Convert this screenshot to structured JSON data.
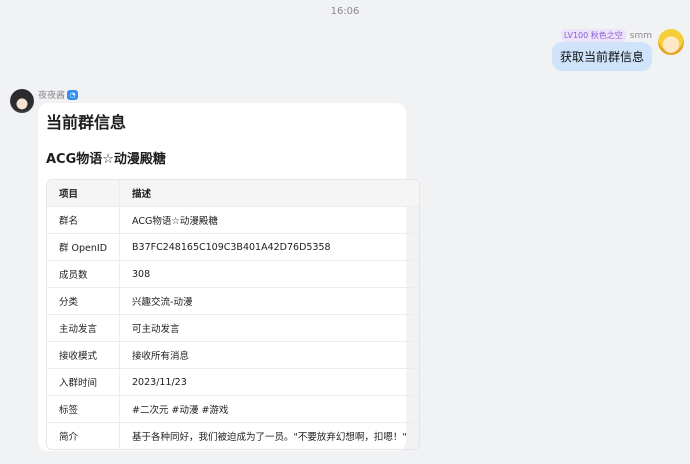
{
  "timestamp": "16:06",
  "outgoing": {
    "level_badge": "LV100 秋色之空",
    "username": "smm",
    "message": "获取当前群信息"
  },
  "incoming": {
    "sender_name": "夜夜酱",
    "bot_icon_glyph": "◔",
    "card": {
      "title": "当前群信息",
      "subtitle": "ACG物语☆动漫殿糖",
      "table": {
        "headers": [
          "项目",
          "描述"
        ],
        "rows": [
          [
            "群名",
            "ACG物语☆动漫殿糖"
          ],
          [
            "群 OpenID",
            "B37FC248165C109C3B401A42D76D5358"
          ],
          [
            "成员数",
            "308"
          ],
          [
            "分类",
            "兴趣交流-动漫"
          ],
          [
            "主动发言",
            "可主动发言"
          ],
          [
            "接收模式",
            "接收所有消息"
          ],
          [
            "入群时间",
            "2023/11/23"
          ],
          [
            "标签",
            "#二次元 #动漫 #游戏"
          ],
          [
            "简介",
            "基于各种同好，我们被迫成为了一员。\"不要放弃幻想啊，扣嗯！\""
          ]
        ]
      }
    }
  },
  "colors": {
    "background": "#f1f2f4",
    "outgoing_bubble": "#cfe4fb",
    "level_badge_text": "#8a5cd6",
    "bot_icon": "#2f8cf5"
  }
}
